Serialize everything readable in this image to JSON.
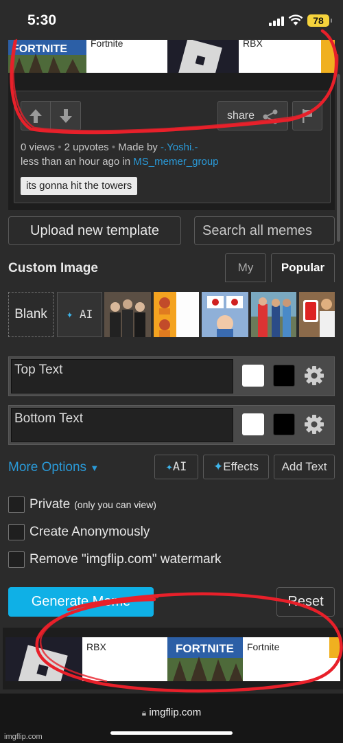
{
  "status_bar": {
    "time": "5:30",
    "battery": "78"
  },
  "top_strip": {
    "items": [
      {
        "title": "Fortnite",
        "logo_text": "FORTNITE"
      },
      {
        "title": "RBX"
      }
    ]
  },
  "post": {
    "views": "0 views",
    "upvotes": "2 upvotes",
    "made_by_prefix": "Made by",
    "author": "-.Yoshi.-",
    "time_prefix": "less than an hour ago in",
    "stream": "MS_memer_group",
    "share_label": "share",
    "tag": "its gonna hit the towers"
  },
  "actions": {
    "upload": "Upload new template",
    "search_placeholder": "Search all memes"
  },
  "templates": {
    "title": "Custom Image",
    "tabs": {
      "my": "My",
      "popular": "Popular"
    },
    "blank": "Blank",
    "ai": "AI"
  },
  "text_boxes": [
    {
      "placeholder": "Top Text"
    },
    {
      "placeholder": "Bottom Text"
    }
  ],
  "options": {
    "more_options": "More Options",
    "ai": "AI",
    "effects": "Effects",
    "add_text": "Add Text"
  },
  "checkboxes": {
    "private_label": "Private",
    "private_note": "(only you can view)",
    "anonymous_label": "Create Anonymously",
    "watermark_label": "Remove \"imgflip.com\" watermark"
  },
  "buttons": {
    "generate": "Generate Meme",
    "reset": "Reset"
  },
  "bottom_strip": {
    "items": [
      {
        "title": "RBX"
      },
      {
        "title": "Fortnite",
        "logo_text": "FORTNITE"
      }
    ]
  },
  "browser": {
    "url": "imgflip.com"
  },
  "watermark": "imgflip.com",
  "colors": {
    "link": "#2a9ad8",
    "generate": "#0fb0e6",
    "annotation": "#e8202a"
  }
}
